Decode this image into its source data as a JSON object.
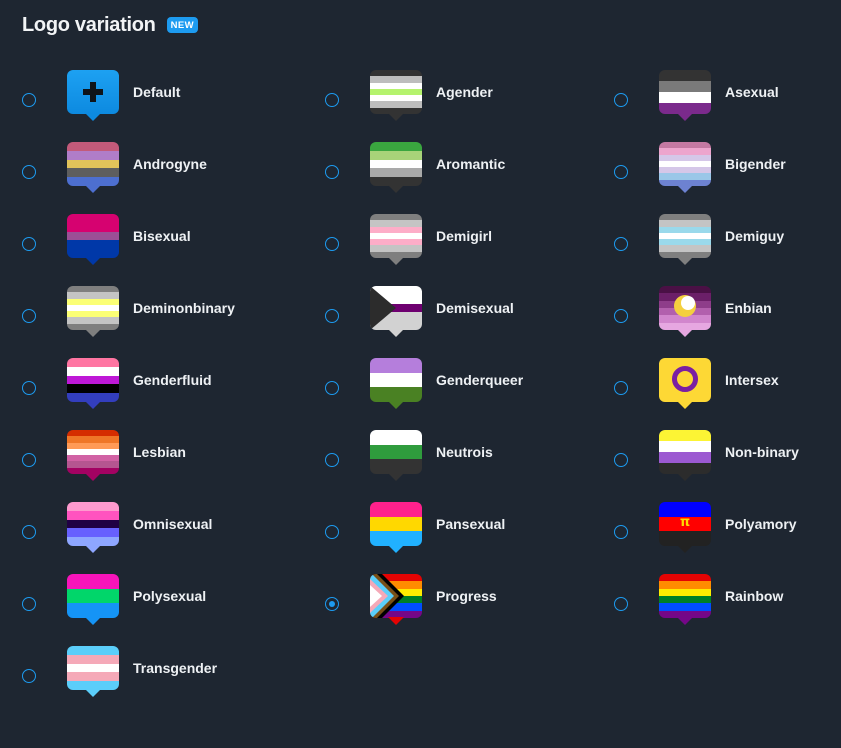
{
  "header": {
    "title": "Logo variation",
    "badge": "NEW"
  },
  "selected": "Progress",
  "options": [
    {
      "name": "Default",
      "col": 0,
      "row": 0,
      "kind": "default"
    },
    {
      "name": "Agender",
      "col": 1,
      "row": 0,
      "stripes": [
        "#333333",
        "#bdbdbd",
        "#ffffff",
        "#b5f36d",
        "#ffffff",
        "#bdbdbd",
        "#333333"
      ]
    },
    {
      "name": "Asexual",
      "col": 2,
      "row": 0,
      "stripes": [
        "#333333",
        "#7a7a7a",
        "#ffffff",
        "#7b2a8c"
      ]
    },
    {
      "name": "Androgyne",
      "col": 0,
      "row": 1,
      "stripes": [
        "#c35a7a",
        "#b07dc8",
        "#e2c35a",
        "#5e5e5e",
        "#4d6fd0"
      ]
    },
    {
      "name": "Aromantic",
      "col": 1,
      "row": 1,
      "stripes": [
        "#3aa63f",
        "#a8d379",
        "#ffffff",
        "#a9a9a9",
        "#333333"
      ]
    },
    {
      "name": "Bigender",
      "col": 2,
      "row": 1,
      "stripes": [
        "#c479a2",
        "#eda5cd",
        "#d5c7e8",
        "#ffffff",
        "#d5c7e8",
        "#9ac7e8",
        "#6d82d1"
      ]
    },
    {
      "name": "Bisexual",
      "col": 0,
      "row": 2,
      "stripes": [
        "#d60270",
        "#d60270",
        "#9b4f96",
        "#0038a8",
        "#0038a8"
      ]
    },
    {
      "name": "Demigirl",
      "col": 1,
      "row": 2,
      "stripes": [
        "#7f7f7f",
        "#c4c4c4",
        "#fdadc8",
        "#ffffff",
        "#fdadc8",
        "#c4c4c4",
        "#7f7f7f"
      ]
    },
    {
      "name": "Demiguy",
      "col": 2,
      "row": 2,
      "stripes": [
        "#7f7f7f",
        "#c4c4c4",
        "#9ad9eb",
        "#ffffff",
        "#9ad9eb",
        "#c4c4c4",
        "#7f7f7f"
      ]
    },
    {
      "name": "Deminonbinary",
      "col": 0,
      "row": 3,
      "stripes": [
        "#7f7f7f",
        "#c4c4c4",
        "#fbff75",
        "#ffffff",
        "#fbff75",
        "#c4c4c4",
        "#7f7f7f"
      ]
    },
    {
      "name": "Demisexual",
      "col": 1,
      "row": 3,
      "kind": "demisexual"
    },
    {
      "name": "Enbian",
      "col": 2,
      "row": 3,
      "kind": "enbian"
    },
    {
      "name": "Genderfluid",
      "col": 0,
      "row": 4,
      "stripes": [
        "#ff75a2",
        "#ffffff",
        "#be18d6",
        "#000000",
        "#333ebd"
      ]
    },
    {
      "name": "Genderqueer",
      "col": 1,
      "row": 4,
      "stripes": [
        "#b57edc",
        "#ffffff",
        "#4a8123"
      ]
    },
    {
      "name": "Intersex",
      "col": 2,
      "row": 4,
      "kind": "intersex"
    },
    {
      "name": "Lesbian",
      "col": 0,
      "row": 5,
      "stripes": [
        "#d52d00",
        "#ef7627",
        "#ff9a56",
        "#ffffff",
        "#d162a4",
        "#b55690",
        "#a30262"
      ]
    },
    {
      "name": "Neutrois",
      "col": 1,
      "row": 5,
      "stripes": [
        "#ffffff",
        "#2f9c3d",
        "#333333"
      ]
    },
    {
      "name": "Non-binary",
      "col": 2,
      "row": 5,
      "stripes": [
        "#fcf434",
        "#ffffff",
        "#9c59d1",
        "#2c2c2c"
      ]
    },
    {
      "name": "Omnisexual",
      "col": 0,
      "row": 6,
      "stripes": [
        "#fe9ace",
        "#ff53bf",
        "#200044",
        "#6760fe",
        "#8ea6ff"
      ]
    },
    {
      "name": "Pansexual",
      "col": 1,
      "row": 6,
      "stripes": [
        "#ff218c",
        "#ffd800",
        "#21b1ff"
      ]
    },
    {
      "name": "Polyamory",
      "col": 2,
      "row": 6,
      "kind": "polyamory",
      "glyph": "π"
    },
    {
      "name": "Polysexual",
      "col": 0,
      "row": 7,
      "stripes": [
        "#f714ba",
        "#01d66a",
        "#1594f6"
      ]
    },
    {
      "name": "Progress",
      "col": 1,
      "row": 7,
      "kind": "progress"
    },
    {
      "name": "Rainbow",
      "col": 2,
      "row": 7,
      "stripes": [
        "#e40303",
        "#ff8c00",
        "#ffed00",
        "#008026",
        "#004dff",
        "#750787"
      ]
    },
    {
      "name": "Transgender",
      "col": 0,
      "row": 8,
      "stripes": [
        "#5bcefa",
        "#f5a9b8",
        "#ffffff",
        "#f5a9b8",
        "#5bcefa"
      ]
    }
  ],
  "colors": {
    "accent": "#1d9bf0",
    "background": "#1e2631",
    "text": "#eef1f4"
  }
}
